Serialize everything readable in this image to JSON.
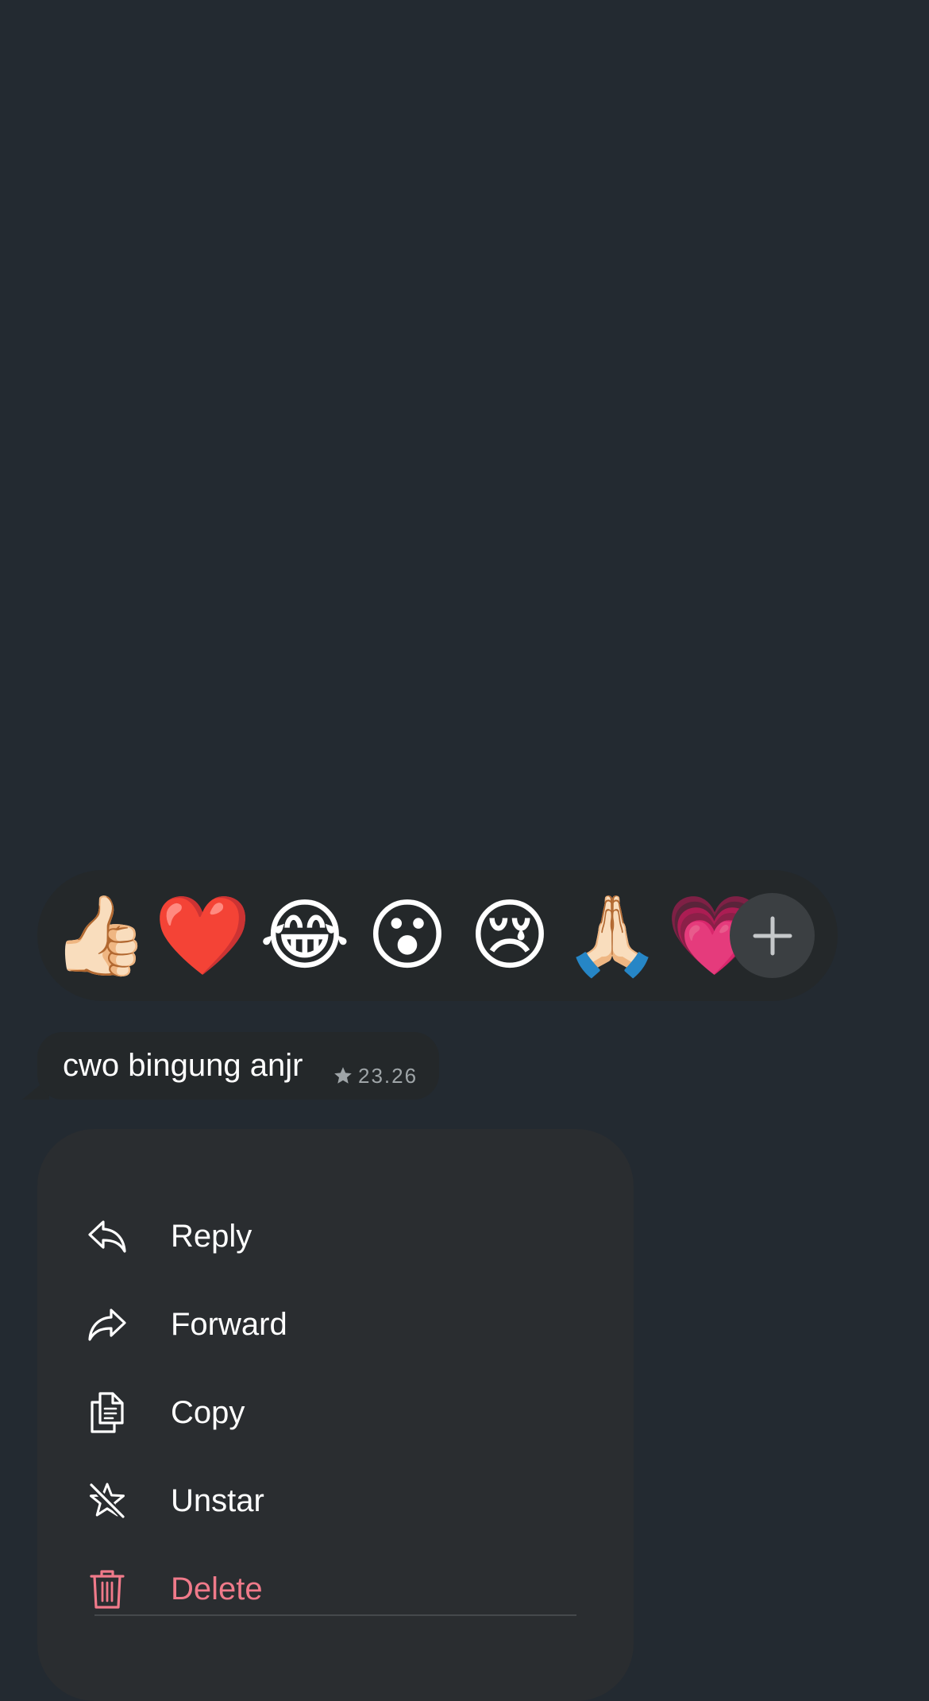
{
  "reactions": {
    "emojis": [
      "👍🏻",
      "❤️",
      "😂",
      "😮",
      "😢",
      "🙏🏻",
      "💗"
    ],
    "more_icon": "plus-icon"
  },
  "message": {
    "text": "cwo bingung anjr",
    "time": "23.26",
    "starred_icon": "star-icon"
  },
  "menu": {
    "items": [
      {
        "label": "Reply",
        "icon": "reply-icon"
      },
      {
        "label": "Forward",
        "icon": "forward-icon"
      },
      {
        "label": "Copy",
        "icon": "copy-icon"
      },
      {
        "label": "Unstar",
        "icon": "unstar-icon"
      },
      {
        "label": "Delete",
        "icon": "trash-icon"
      }
    ]
  },
  "colors": {
    "background": "#232a31",
    "bubble": "#24282a",
    "menu": "#2a2d30",
    "destructive": "#f07a8a",
    "meta_text": "#9fa5a8"
  }
}
